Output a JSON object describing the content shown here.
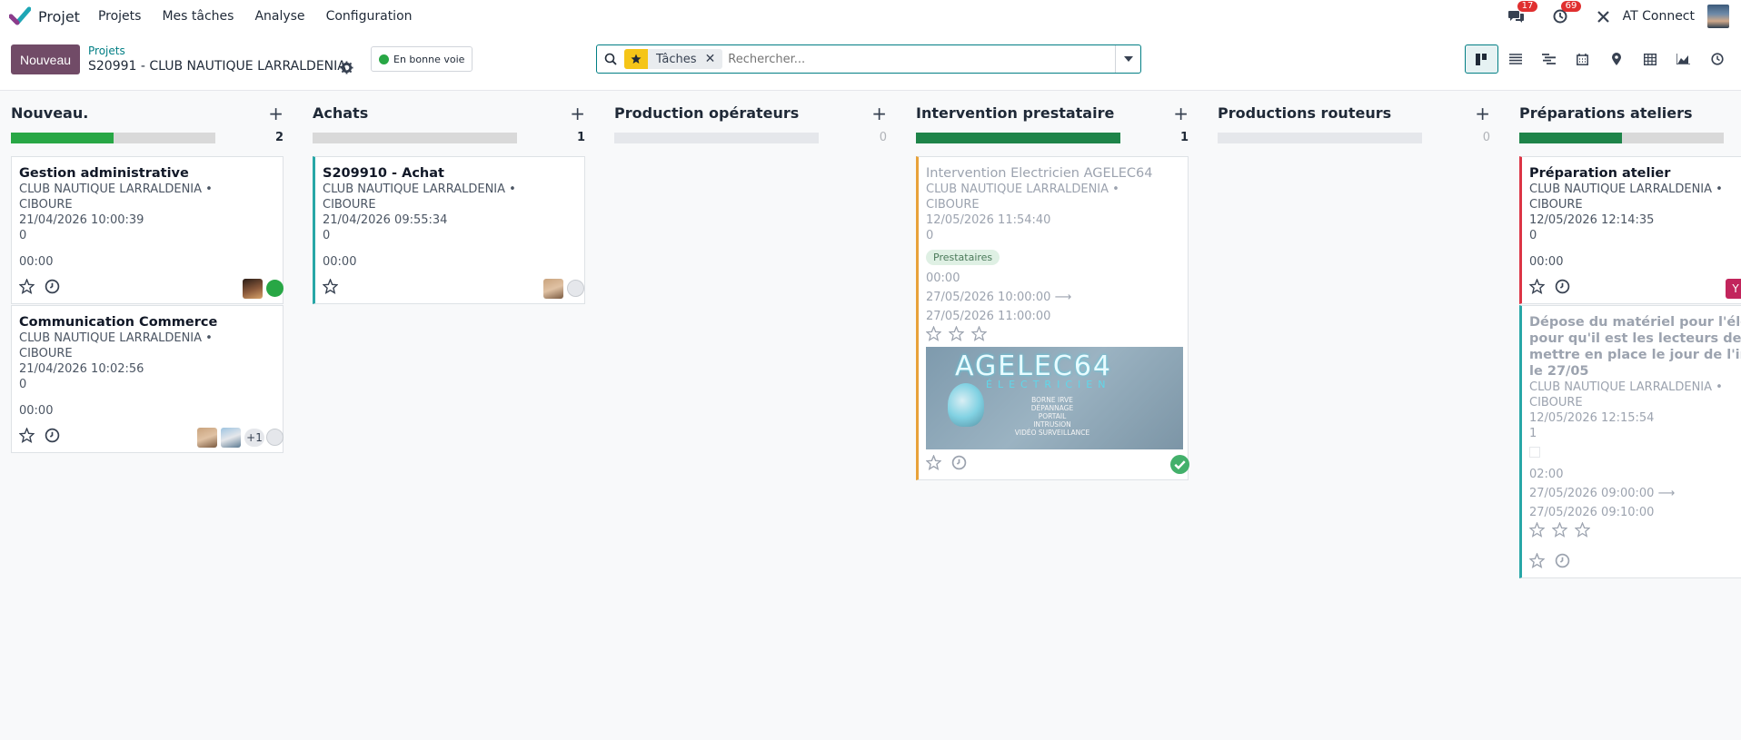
{
  "app": {
    "name": "Projet"
  },
  "menu": [
    "Projets",
    "Mes tâches",
    "Analyse",
    "Configuration"
  ],
  "systray": {
    "messages_count": "17",
    "activities_count": "69",
    "company": "AT Connect"
  },
  "control_panel": {
    "new_label": "Nouveau",
    "breadcrumb_parent": "Projets",
    "breadcrumb_current": "S20991 - CLUB NAUTIQUE LARRALDENIA",
    "status_label": "En bonne voie",
    "search": {
      "facet": "Tâches",
      "placeholder": "Rechercher..."
    },
    "views": [
      "kanban-view-icon",
      "list-view-icon",
      "gantt-view-icon",
      "calendar-view-icon",
      "map-view-icon",
      "pivot-view-icon",
      "graph-view-icon",
      "activity-view-icon"
    ]
  },
  "colors": {
    "accent": "#714b67",
    "teal": "#017e84",
    "green": "#28a745",
    "progress_green": "#1e8449",
    "progress_bg": "#d9d9d9"
  },
  "columns": [
    {
      "title": "Nouveau.",
      "count": "2",
      "progress_done": 0.5,
      "cards": [
        {
          "title": "Gestion administrative",
          "customer": "CLUB NAUTIQUE LARRALDENIA •",
          "city": "CIBOURE",
          "date": "21/04/2026 10:00:39",
          "count": "0",
          "hours": "00:00"
        },
        {
          "title": "Communication Commerce",
          "customer": "CLUB NAUTIQUE LARRALDENIA •",
          "city": "CIBOURE",
          "date": "21/04/2026 10:02:56",
          "count": "0",
          "hours": "00:00",
          "extra_assignees": "+1"
        }
      ]
    },
    {
      "title": "Achats",
      "count": "1",
      "progress_done": 0,
      "cards": [
        {
          "title": "S209910 - Achat",
          "customer": "CLUB NAUTIQUE LARRALDENIA •",
          "city": "CIBOURE",
          "date": "21/04/2026 09:55:34",
          "count": "0",
          "hours": "00:00"
        }
      ]
    },
    {
      "title": "Production opérateurs",
      "count": "0",
      "progress_done": 0,
      "cards": []
    },
    {
      "title": "Intervention prestataire",
      "count": "1",
      "progress_done": 1,
      "cards": [
        {
          "title": "Intervention Electricien AGELEC64",
          "customer": "CLUB NAUTIQUE LARRALDENIA •",
          "city": "CIBOURE",
          "date": "12/05/2026 11:54:40",
          "count": "0",
          "tag": "Prestataires",
          "hours": "00:00",
          "start": "27/05/2026 10:00:00",
          "end": "27/05/2026 11:00:00",
          "cover": {
            "brand": "AGELEC64",
            "subtitle": "ÉLECTRICIEN",
            "services": [
              "BORNE IRVE",
              "DÉPANNAGE",
              "PORTAIL",
              "INTRUSION",
              "VIDÉO SURVEILLANCE"
            ]
          }
        }
      ]
    },
    {
      "title": "Productions routeurs",
      "count": "0",
      "progress_done": 0,
      "cards": []
    },
    {
      "title": "Préparations ateliers",
      "count": "",
      "progress_done": 0.5,
      "cards": [
        {
          "title": "Préparation atelier",
          "customer": "CLUB NAUTIQUE LARRALDENIA •",
          "city": "CIBOURE",
          "date": "12/05/2026 12:14:35",
          "count": "0",
          "hours": "00:00",
          "assignee_initial": "Y"
        },
        {
          "title_lines": [
            "Dépose du matériel pour l'électri",
            "pour qu'il est les lecteurs de bad",
            "mettre en place le jour de l'interv",
            "le 27/05"
          ],
          "customer": "CLUB NAUTIQUE LARRALDENIA •",
          "city": "CIBOURE",
          "date": "12/05/2026 12:15:54",
          "count": "1",
          "hours": "02:00",
          "start": "27/05/2026 09:00:00",
          "end": "27/05/2026 09:10:00"
        }
      ]
    }
  ]
}
